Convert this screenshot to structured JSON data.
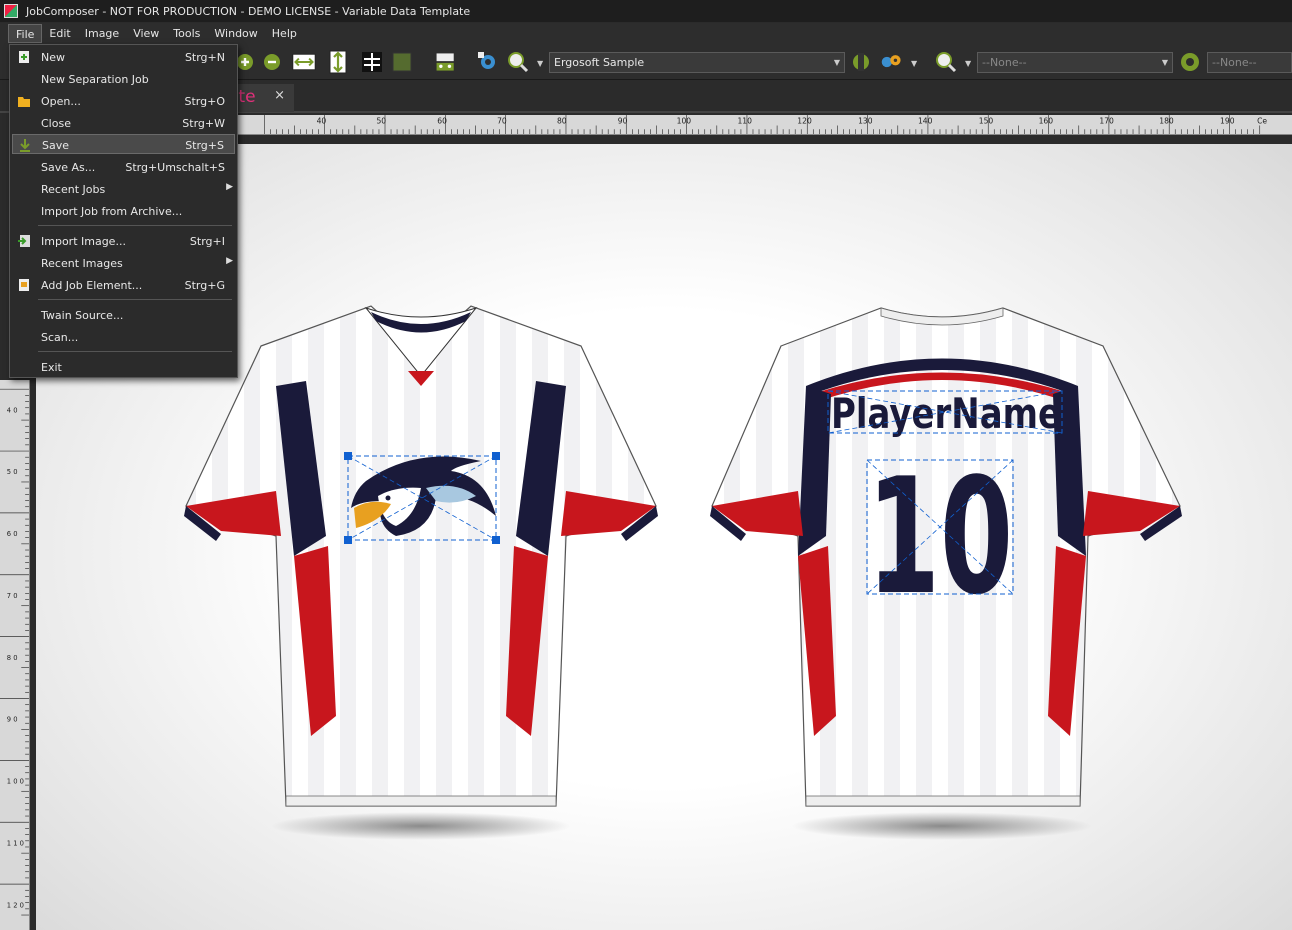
{
  "titlebar": {
    "title": "JobComposer - NOT FOR PRODUCTION - DEMO LICENSE - Variable Data Template"
  },
  "menubar": {
    "items": [
      "File",
      "Edit",
      "Image",
      "View",
      "Tools",
      "Window",
      "Help"
    ]
  },
  "toolbar": {
    "profile_select": "Ergosoft Sample",
    "select_2": "--None--",
    "select_3": "--None--"
  },
  "document_tab": {
    "label_visible": "ate",
    "close": "×"
  },
  "ruler": {
    "h_labels": [
      "40",
      "50",
      "60",
      "70",
      "80",
      "90",
      "100",
      "110",
      "120",
      "130",
      "140",
      "150",
      "160",
      "170",
      "180",
      "190",
      "Ce"
    ],
    "v_labels": [
      "4\n0",
      "5\n0",
      "6\n0",
      "7\n0",
      "8\n0",
      "9\n0",
      "1\n0\n0",
      "1\n1\n0",
      "1\n2\n0"
    ]
  },
  "file_menu": {
    "items": [
      {
        "label": "New",
        "shortcut": "Strg+N",
        "icon": "new-plus-icon"
      },
      {
        "label": "New Separation Job",
        "shortcut": ""
      },
      {
        "label": "Open...",
        "shortcut": "Strg+O",
        "icon": "folder-icon"
      },
      {
        "label": "Close",
        "shortcut": "Strg+W"
      },
      {
        "label": "Save",
        "shortcut": "Strg+S",
        "icon": "save-arrow-icon",
        "highlighted": true
      },
      {
        "label": "Save As...",
        "shortcut": "Strg+Umschalt+S"
      },
      {
        "label": "Recent Jobs",
        "shortcut": "",
        "submenu": true
      },
      {
        "label": "Import Job from Archive...",
        "shortcut": ""
      },
      {
        "label": "Import Image...",
        "shortcut": "Strg+I",
        "icon": "import-image-icon"
      },
      {
        "label": "Recent Images",
        "shortcut": "",
        "submenu": true
      },
      {
        "label": "Add Job Element...",
        "shortcut": "Strg+G",
        "icon": "add-element-icon"
      },
      {
        "label": "Twain Source...",
        "shortcut": ""
      },
      {
        "label": "Scan...",
        "shortcut": ""
      },
      {
        "label": "Exit",
        "shortcut": ""
      }
    ]
  },
  "canvas": {
    "player_name": "PlayerName",
    "player_number": "10",
    "colors": {
      "navy": "#1a1a3a",
      "red": "#c8161d",
      "selection": "#1060d0",
      "shirt": "#ffffff"
    }
  }
}
